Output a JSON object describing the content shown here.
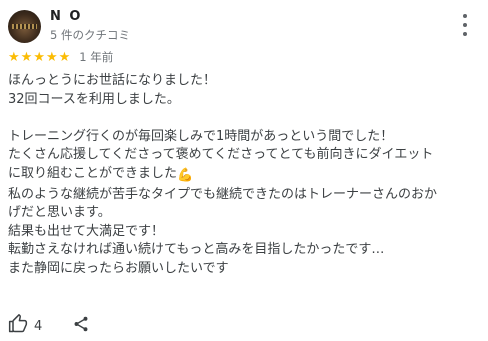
{
  "review": {
    "author_name": "N O",
    "author_reviews": "5 件のクチコミ",
    "rating": 5,
    "rating_max": 5,
    "date": "1 年前",
    "lines": [
      "ほんっとうにお世話になりました！",
      "32回コースを利用しました。",
      "",
      "トレーニング行くのが毎回楽しみで1時間があっという間でした！",
      "たくさん応援してくださって褒めてくださってとても前向きにダイエット",
      "に取り組むことができました",
      "私のような継続が苦手なタイプでも継続できたのはトレーナーさんのおか",
      "げだと思います。",
      "結果も出せて大満足です！",
      "転勤さえなければ通い続けてもっと高みを目指したかったです…",
      "また静岡に戻ったらお願いしたいです"
    ],
    "emoji": "💪"
  },
  "actions": {
    "like_count": "4"
  },
  "icons": {
    "more": "more-vert-icon",
    "star": "star-icon",
    "like": "thumb-up-icon",
    "share": "share-icon",
    "emoji": "flexed-biceps-emoji"
  },
  "colors": {
    "star": "#fbbc04",
    "text": "#3c4043",
    "secondary": "#70757a"
  }
}
